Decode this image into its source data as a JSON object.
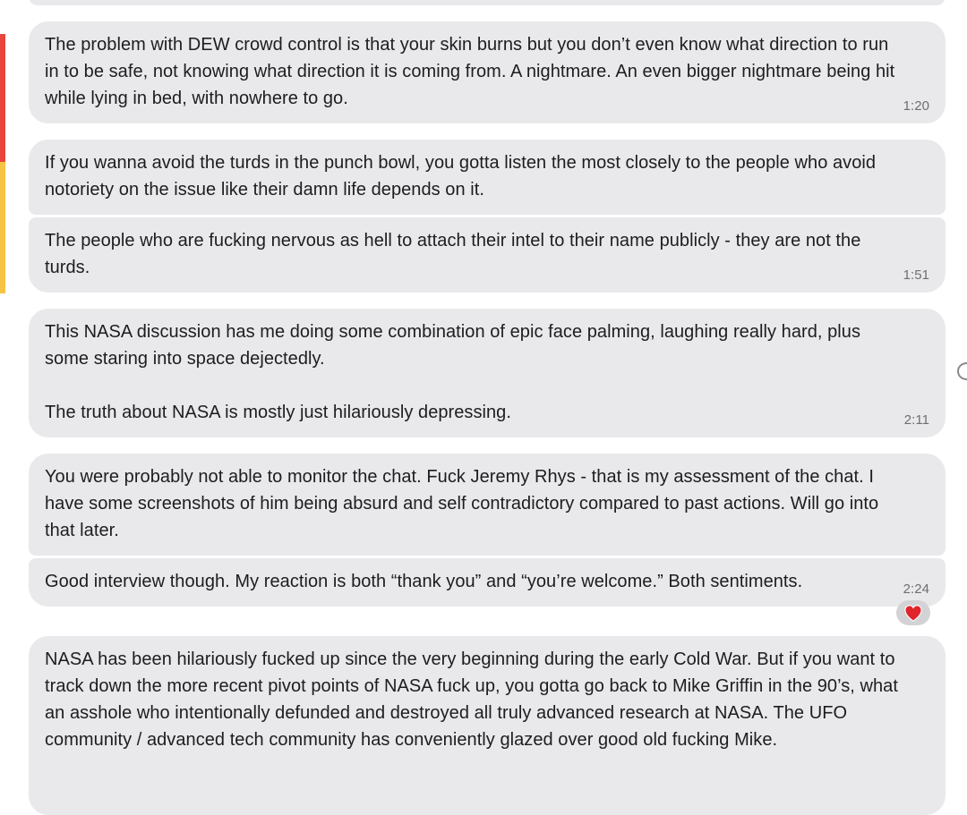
{
  "messages": [
    {
      "text": "The problem with DEW crowd control is that your skin burns but you don’t even know what direction to run in to be safe, not knowing what direction it is coming from. A nightmare. An even bigger nightmare being hit while lying in bed, with nowhere to go.",
      "time": "1:20"
    },
    {
      "text": "If you wanna avoid the turds in the punch bowl, you gotta listen the most closely to the people who avoid notoriety on the issue like their damn life depends on it.",
      "time": ""
    },
    {
      "text": "The people who are fucking nervous as hell to attach their intel to their name publicly - they are not the turds.",
      "time": "1:51"
    },
    {
      "text": "This NASA discussion has me doing some combination of epic face palming, laughing really hard, plus some staring into space dejectedly.\n\nThe truth about NASA is mostly just hilariously depressing.",
      "time": "2:11"
    },
    {
      "text": "You were probably not able to monitor the chat. Fuck Jeremy Rhys - that is my assessment of the chat. I have some screenshots of him being absurd and self contradictory compared to past actions. Will go into that later.",
      "time": ""
    },
    {
      "text": "Good interview though. My reaction is both “thank you” and “you’re welcome.” Both sentiments.",
      "time": "2:24",
      "reaction": "❤️"
    },
    {
      "text": "NASA has been hilariously fucked up since the very beginning during the early Cold War. But if you want to track down the more recent pivot points of NASA fuck up, you gotta go back to Mike Griffin in the 90’s, what an asshole who intentionally defunded and destroyed all truly advanced research at NASA. The UFO community / advanced tech community has conveniently glazed over good old fucking Mike.",
      "time": ""
    }
  ],
  "colors": {
    "bubble": "#e9e9eb",
    "edge_red": "#e8453c",
    "edge_yellow": "#f6c343",
    "heart": "#e0242b"
  }
}
